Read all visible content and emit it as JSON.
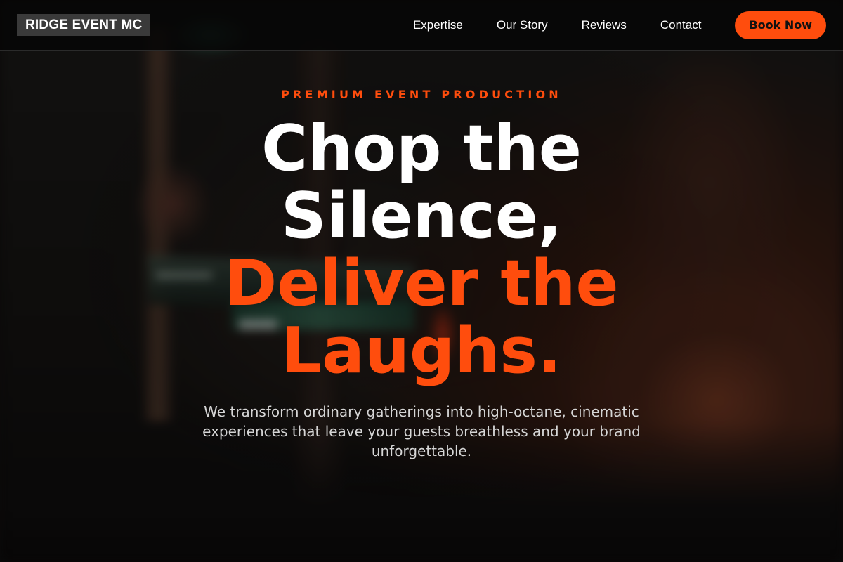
{
  "brand": {
    "logo_text": "RIDGE EVENT MC",
    "accent_color": "#ff4d0d"
  },
  "nav": {
    "links": [
      "Expertise",
      "Our Story",
      "Reviews",
      "Contact"
    ],
    "cta_label": "Book Now"
  },
  "hero": {
    "eyebrow": "PREMIUM EVENT PRODUCTION",
    "headline_white": [
      "Chop the",
      "Silence,"
    ],
    "headline_accent": [
      "Deliver the",
      "Laughs."
    ],
    "subtext": "We transform ordinary gatherings into high-octane, cinematic experiences that leave your guests breathless and your brand unforgettable."
  }
}
